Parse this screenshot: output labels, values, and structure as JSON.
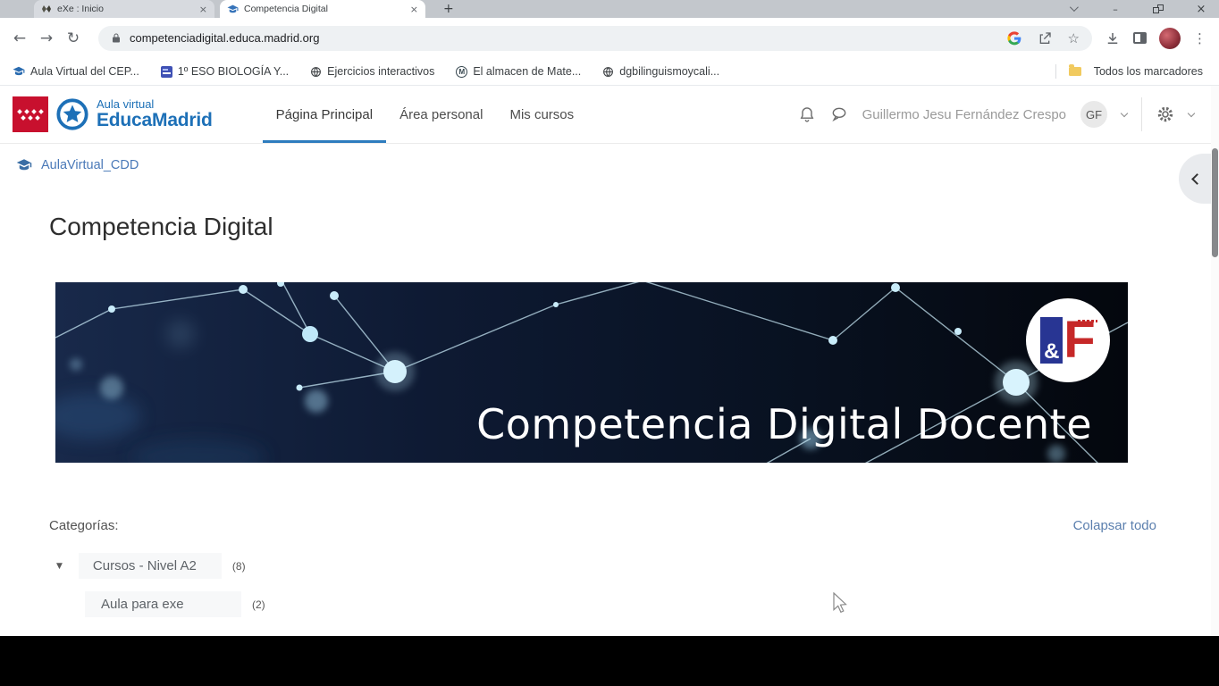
{
  "icons": {
    "minimize": "–",
    "close": "×",
    "tab_close": "×",
    "new_tab": "+",
    "back": "←",
    "forward": "→",
    "reload": "↻",
    "star": "☆",
    "more": "⋮",
    "triangle_down": "▼"
  },
  "browser": {
    "tabs": [
      {
        "title": "eXe : Inicio",
        "active": false
      },
      {
        "title": "Competencia Digital",
        "active": true
      }
    ],
    "address": {
      "url": "competenciadigital.educa.madrid.org",
      "google_g": "G"
    },
    "bookmarks": [
      {
        "label": "Aula Virtual del CEP..."
      },
      {
        "label": "1º ESO BIOLOGÍA Y..."
      },
      {
        "label": "Ejercicios interactivos"
      },
      {
        "label": "El almacen de Mate...",
        "monogram": "M"
      },
      {
        "label": "dgbilinguismoycali..."
      }
    ],
    "bookmarks_all": "Todos los marcadores"
  },
  "site": {
    "logo": {
      "line1": "Aula virtual",
      "line2": "EducaMadrid"
    },
    "nav": [
      {
        "label": "Página Principal",
        "active": true
      },
      {
        "label": "Área personal",
        "active": false
      },
      {
        "label": "Mis cursos",
        "active": false
      }
    ],
    "user": {
      "name": "Guillermo Jesu Fernández Crespo",
      "initials": "GF"
    },
    "breadcrumb": "AulaVirtual_CDD"
  },
  "page": {
    "title": "Competencia Digital",
    "banner": {
      "title": "Competencia Digital Docente",
      "logo_amp": "&",
      "logo_f": "F"
    },
    "categories_label": "Categorías:",
    "collapse_all": "Colapsar todo",
    "categories": [
      {
        "name": "Cursos - Nivel A2",
        "count": "(8)"
      },
      {
        "name": "Aula para exe",
        "count": "(2)"
      }
    ]
  },
  "colors": {
    "brand_blue": "#1d70b7",
    "nav_active_underline": "#2e7cbe",
    "link_blue": "#4a79b8",
    "madrid_red": "#c8102e",
    "banner_navy_left": "#18294a",
    "banner_navy_right": "#04070d",
    "banner_logo_blue": "#283593",
    "banner_logo_red": "#c62828"
  }
}
